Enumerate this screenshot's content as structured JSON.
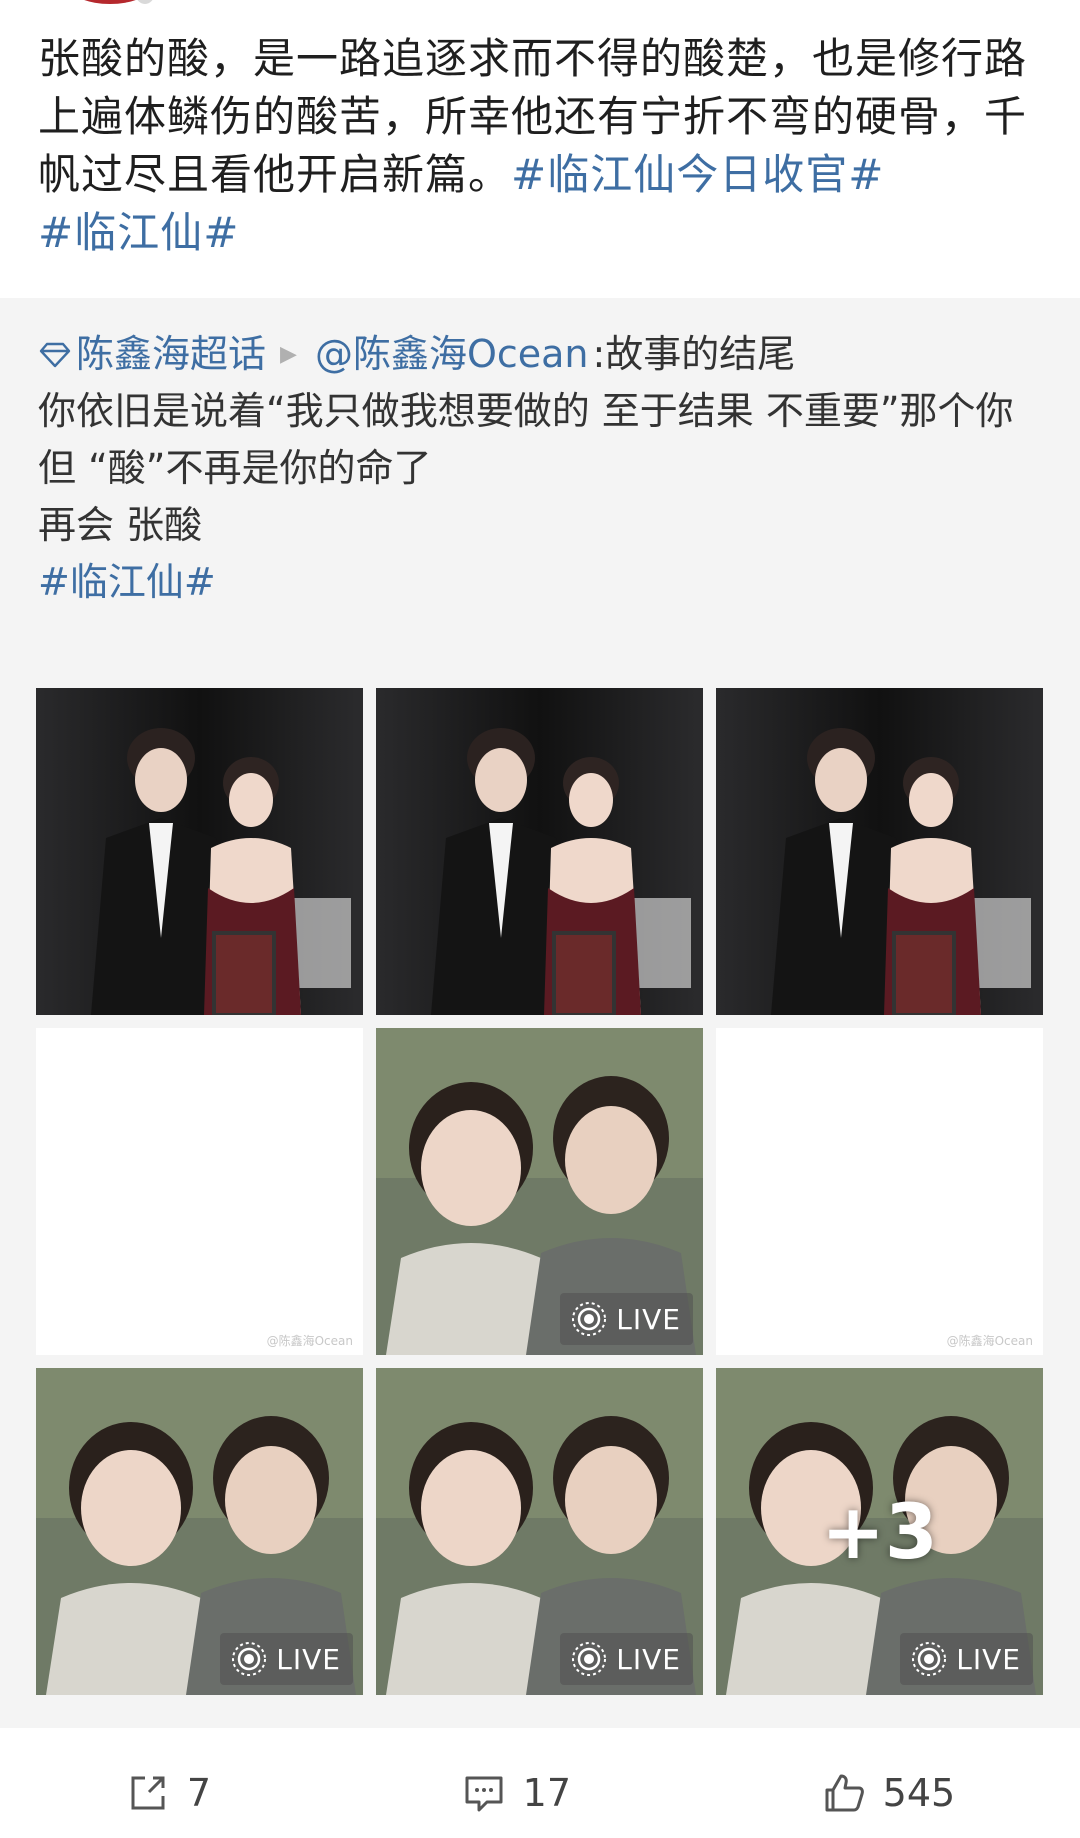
{
  "post": {
    "text": "张酸的酸，是一路追逐求而不得的酸楚，也是修行路上遍体鳞伤的酸苦，所幸他还有宁折不弯的硬骨，千帆过尽且看他开启新篇。",
    "hashtag_1": "#临江仙今日收官#",
    "hashtag_2": "#临江仙#"
  },
  "repost": {
    "supertopic": "陈鑫海超话",
    "author": "@陈鑫海Ocean",
    "title": ":故事的结尾",
    "line_1": "你依旧是说着“我只做我想要做的  至于结果  不重要”那个你",
    "line_2": "但 “酸”不再是你的命了",
    "line_3": "再会 张酸",
    "hashtag": "#临江仙#"
  },
  "images": [
    {
      "kind": "photo-red-carpet"
    },
    {
      "kind": "photo-red-carpet"
    },
    {
      "kind": "photo-red-carpet"
    },
    {
      "kind": "blank",
      "watermark": "@陈鑫海Ocean"
    },
    {
      "kind": "photo-costume",
      "live": "LIVE"
    },
    {
      "kind": "blank",
      "watermark": "@陈鑫海Ocean"
    },
    {
      "kind": "photo-costume",
      "live": "LIVE"
    },
    {
      "kind": "photo-costume",
      "live": "LIVE"
    },
    {
      "kind": "photo-costume",
      "live": "LIVE",
      "more": "+3"
    }
  ],
  "actions": {
    "share_count": "7",
    "comment_count": "17",
    "like_count": "545"
  },
  "colors": {
    "link": "#3e6ea3",
    "repost_bg": "#f4f4f4"
  },
  "icons": {
    "share": "share-arrow-icon",
    "comment": "comment-bubble-icon",
    "like": "thumbs-up-icon",
    "supertopic": "diamond-icon",
    "live": "live-target-icon"
  }
}
